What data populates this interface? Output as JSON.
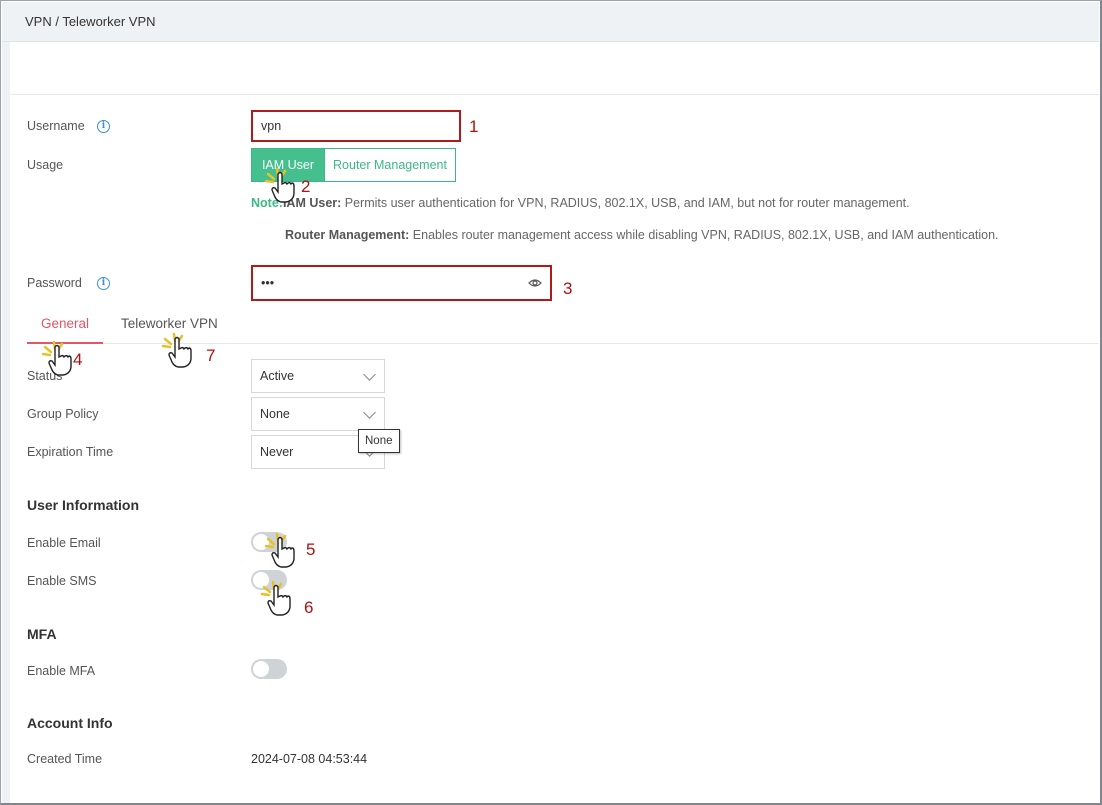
{
  "breadcrumb": "VPN / Teleworker VPN",
  "form": {
    "username_label": "Username",
    "username_value": "vpn",
    "usage_label": "Usage",
    "usage_options": [
      "IAM User",
      "Router Management"
    ],
    "usage_selected": "IAM User",
    "note_prefix": "Note:",
    "note_iam_title": "IAM User:",
    "note_iam_text": " Permits user authentication for VPN, RADIUS, 802.1X, USB, and IAM, but not for router management.",
    "note_router_title": "Router Management:",
    "note_router_text": " Enables router management access while disabling VPN, RADIUS, 802.1X, USB, and IAM authentication.",
    "password_label": "Password",
    "password_value": "•••"
  },
  "tabs": [
    {
      "label": "General",
      "active": true
    },
    {
      "label": "Teleworker VPN",
      "active": false
    }
  ],
  "general": {
    "status_label": "Status",
    "status_value": "Active",
    "group_policy_label": "Group Policy",
    "group_policy_value": "None",
    "group_policy_tooltip": "None",
    "expiration_label": "Expiration Time",
    "expiration_value": "Never"
  },
  "user_info": {
    "title": "User Information",
    "enable_email_label": "Enable Email",
    "enable_email": false,
    "enable_sms_label": "Enable SMS",
    "enable_sms": false
  },
  "mfa": {
    "title": "MFA",
    "enable_mfa_label": "Enable MFA",
    "enable_mfa": false
  },
  "account": {
    "title": "Account Info",
    "created_time_label": "Created Time",
    "created_time_value": "2024-07-08 04:53:44"
  },
  "annotations": [
    "1",
    "2",
    "3",
    "4",
    "5",
    "6",
    "7"
  ],
  "colors": {
    "accent_green": "#45bf8d",
    "tab_active": "#e0566a",
    "annotation_red": "#b01010",
    "info_blue": "#3a8fd8"
  }
}
